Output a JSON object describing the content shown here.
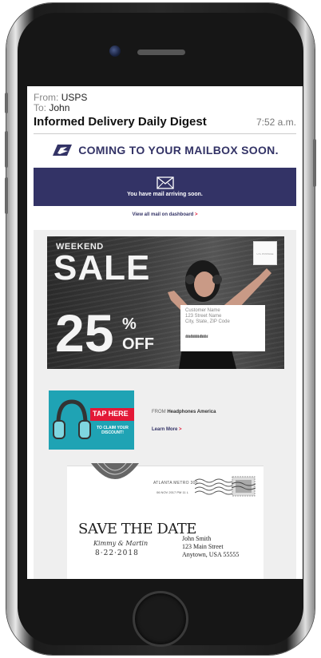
{
  "email": {
    "from_key": "From:",
    "from_value": "USPS",
    "to_key": "To:",
    "to_value": "John",
    "subject": "Informed Delivery Daily Digest",
    "time": "7:52 a.m."
  },
  "digest": {
    "heading": "COMING TO YOUR MAILBOX SOON.",
    "banner_text": "You have mail arriving soon.",
    "dashboard_link": "View all mail on dashboard",
    "link_arrow": ">"
  },
  "mailpiece_sale": {
    "weekend": "WEEKEND",
    "title": "SALE",
    "percent": "25",
    "percent_sign": "%",
    "off": "OFF",
    "stamp_text": "U.S. POSTAGE",
    "address_lines": [
      "Customer Name",
      "123 Street Name",
      "City, State, ZIP Code"
    ],
    "barcode": "ıllılılıılllılılıllılılıılllılılıllııl"
  },
  "ad": {
    "tap_here": "TAP HERE",
    "claim": "TO CLAIM YOUR DISCOUNT!",
    "from_prefix": "FROM",
    "from_brand": "Headphones America",
    "learn_more": "Learn More",
    "arrow": ">"
  },
  "save_the_date": {
    "postmark_city": "ATLANTA METRO 300",
    "postmark_date": "06 NOV 2017 PM 11 L",
    "title": "SAVE THE DATE",
    "names": "Kimmy & Martin",
    "date": "8·22·2018",
    "recipient_lines": [
      "John Smith",
      "123 Main Street",
      "Anytown, USA 55555"
    ]
  },
  "colors": {
    "usps_navy": "#333366",
    "usps_red": "#e31837",
    "ad_teal": "#1fa3b4"
  }
}
